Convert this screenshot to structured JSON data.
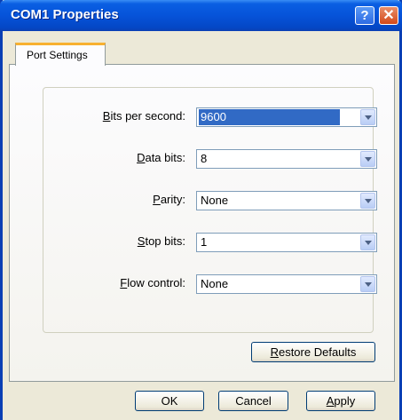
{
  "window": {
    "title": "COM1 Properties"
  },
  "titlebar": {
    "help_glyph": "?",
    "close_glyph": "✕"
  },
  "tabs": [
    {
      "label": "Port Settings",
      "active": true
    }
  ],
  "fields": [
    {
      "key": "B",
      "rest": "its per second:",
      "value": "9600"
    },
    {
      "key": "D",
      "rest": "ata bits:",
      "value": "8"
    },
    {
      "key": "P",
      "rest": "arity:",
      "value": "None"
    },
    {
      "key": "S",
      "rest": "top bits:",
      "value": "1"
    },
    {
      "key": "F",
      "rest": "low control:",
      "value": "None"
    }
  ],
  "buttons": {
    "restore": {
      "key": "R",
      "rest": "estore Defaults"
    },
    "ok": {
      "label": "OK"
    },
    "cancel": {
      "label": "Cancel"
    },
    "apply": {
      "key": "A",
      "rest": "pply"
    }
  }
}
